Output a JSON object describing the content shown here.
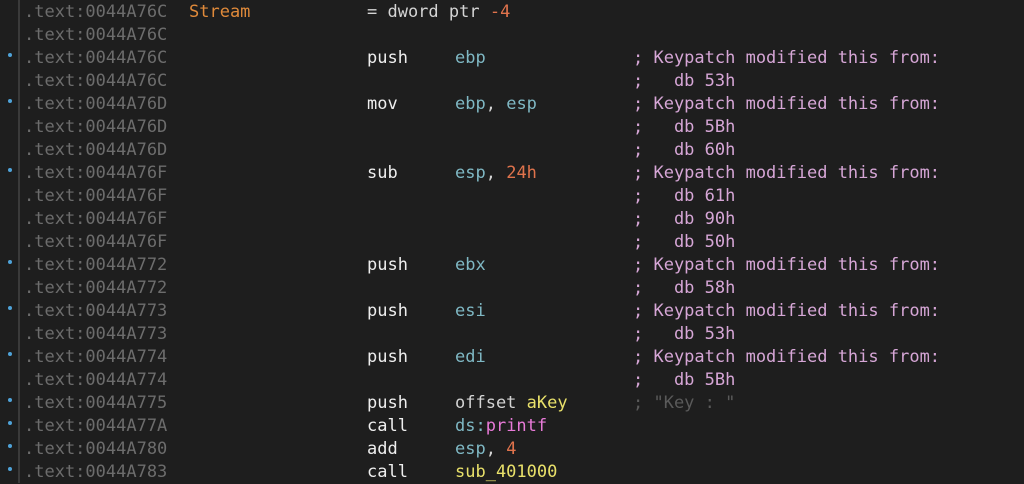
{
  "title": "IDA View disassembly",
  "colors": {
    "background": "#1e1e1e",
    "address": "#6c6c6c",
    "label": "#e08a3a",
    "register": "#7fb8c4",
    "number": "#e0734c",
    "comment": "#d6a6d6",
    "breakpoint_dot": "#4fa3d9"
  },
  "lines": [
    {
      "addr": ".text:0044A76C",
      "label": "Stream",
      "def": "= dword ptr ",
      "def_num": "-4"
    },
    {
      "addr": ".text:0044A76C"
    },
    {
      "addr": ".text:0044A76C",
      "dot": true,
      "mnem": "push",
      "op1": "ebp",
      "op1_class": "reg",
      "comment": "; Keypatch modified this from:"
    },
    {
      "addr": ".text:0044A76C",
      "comment": ";   db 53h"
    },
    {
      "addr": ".text:0044A76D",
      "dot": true,
      "mnem": "mov",
      "op1": "ebp",
      "op1_class": "reg",
      "op_sep": ", ",
      "op2": "esp",
      "op2_class": "reg",
      "comment": "; Keypatch modified this from:"
    },
    {
      "addr": ".text:0044A76D",
      "comment": ";   db 5Bh"
    },
    {
      "addr": ".text:0044A76D",
      "comment": ";   db 60h"
    },
    {
      "addr": ".text:0044A76F",
      "dot": true,
      "mnem": "sub",
      "op1": "esp",
      "op1_class": "reg",
      "op_sep": ", ",
      "op2": "24h",
      "op2_class": "num",
      "comment": "; Keypatch modified this from:"
    },
    {
      "addr": ".text:0044A76F",
      "comment": ";   db 61h"
    },
    {
      "addr": ".text:0044A76F",
      "comment": ";   db 90h"
    },
    {
      "addr": ".text:0044A76F",
      "comment": ";   db 50h"
    },
    {
      "addr": ".text:0044A772",
      "dot": true,
      "mnem": "push",
      "op1": "ebx",
      "op1_class": "reg",
      "comment": "; Keypatch modified this from:"
    },
    {
      "addr": ".text:0044A772",
      "comment": ";   db 58h"
    },
    {
      "addr": ".text:0044A773",
      "dot": true,
      "mnem": "push",
      "op1": "esi",
      "op1_class": "reg",
      "comment": "; Keypatch modified this from:"
    },
    {
      "addr": ".text:0044A773",
      "comment": ";   db 53h"
    },
    {
      "addr": ".text:0044A774",
      "dot": true,
      "mnem": "push",
      "op1": "edi",
      "op1_class": "reg",
      "comment": "; Keypatch modified this from:"
    },
    {
      "addr": ".text:0044A774",
      "comment": ";   db 5Bh"
    },
    {
      "addr": ".text:0044A775",
      "dot": true,
      "mnem": "push",
      "op1": "offset ",
      "op1_class": "kw",
      "op_sep": "",
      "op2": "aKey",
      "op2_class": "func",
      "comment": "; \"Key : \"",
      "comment_dim": true
    },
    {
      "addr": ".text:0044A77A",
      "dot": true,
      "mnem": "call",
      "op1": "ds:",
      "op1_class": "reg",
      "op_sep": "",
      "op2": "printf",
      "op2_class": "ext"
    },
    {
      "addr": ".text:0044A780",
      "dot": true,
      "mnem": "add",
      "op1": "esp",
      "op1_class": "reg",
      "op_sep": ", ",
      "op2": "4",
      "op2_class": "num"
    },
    {
      "addr": ".text:0044A783",
      "dot": true,
      "mnem": "call",
      "op1": "sub_401000",
      "op1_class": "func"
    }
  ]
}
